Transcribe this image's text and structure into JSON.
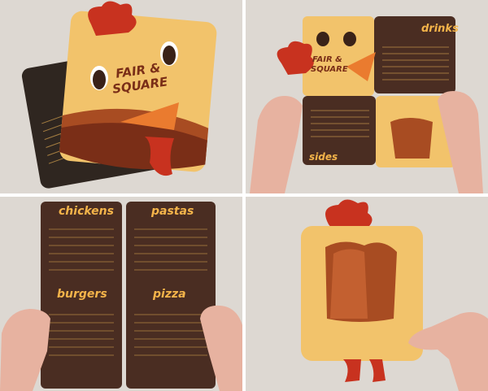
{
  "logo": {
    "line1": "FAIR &",
    "line2": "SQUARE"
  },
  "sections": {
    "drinks": "drinks",
    "sides": "sides",
    "chickens": "chickens",
    "pastas": "pastas",
    "burgers": "burgers",
    "pizza": "pizza"
  },
  "colors": {
    "background": "#ddd8d2",
    "menu_brown": "#4a2d22",
    "cover_yellow": "#f2c36b",
    "comb_red": "#c8321f",
    "beak_orange": "#ea7b2f",
    "title_orange": "#f4b44a"
  }
}
